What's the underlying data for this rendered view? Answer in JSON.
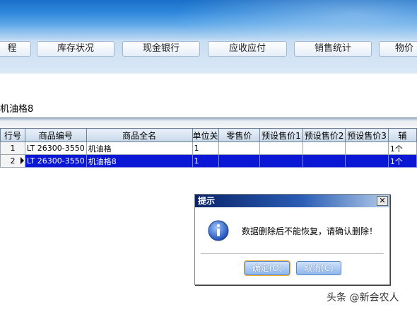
{
  "nav": {
    "items": [
      {
        "label": "程"
      },
      {
        "label": "库存状况"
      },
      {
        "label": "现金银行"
      },
      {
        "label": "应收应付"
      },
      {
        "label": "销售统计"
      },
      {
        "label": "物价"
      }
    ]
  },
  "product": {
    "label": "机油格8"
  },
  "grid": {
    "headers": [
      "行号",
      "商品编号",
      "商品全名",
      "单位关",
      "零售价",
      "预设售价1",
      "预设售价2",
      "预设售价3",
      "辅"
    ],
    "rows": [
      {
        "no": "1",
        "code": "LT 26300-3550",
        "name": "机油格",
        "unit": "1",
        "retail": "",
        "p1": "",
        "p2": "",
        "p3": "",
        "aux": "1个"
      },
      {
        "no": "2",
        "code": "LT 26300-3550",
        "name": "机油格8",
        "unit": "1",
        "retail": "",
        "p1": "",
        "p2": "",
        "p3": "",
        "aux": "1个"
      }
    ],
    "selected_row": 2
  },
  "dialog": {
    "title": "提示",
    "close": "✕",
    "message": "数据删除后不能恢复，请确认删除！",
    "ok_label": "确定(O)",
    "cancel_label": "取消(C)"
  },
  "watermark": "头条 @新会农人",
  "colors": {
    "selection": "#0a18d6",
    "dialog_title": "#0a246a",
    "banner": "#2d86da"
  },
  "icons": {
    "dialog_icon": "info-icon"
  }
}
